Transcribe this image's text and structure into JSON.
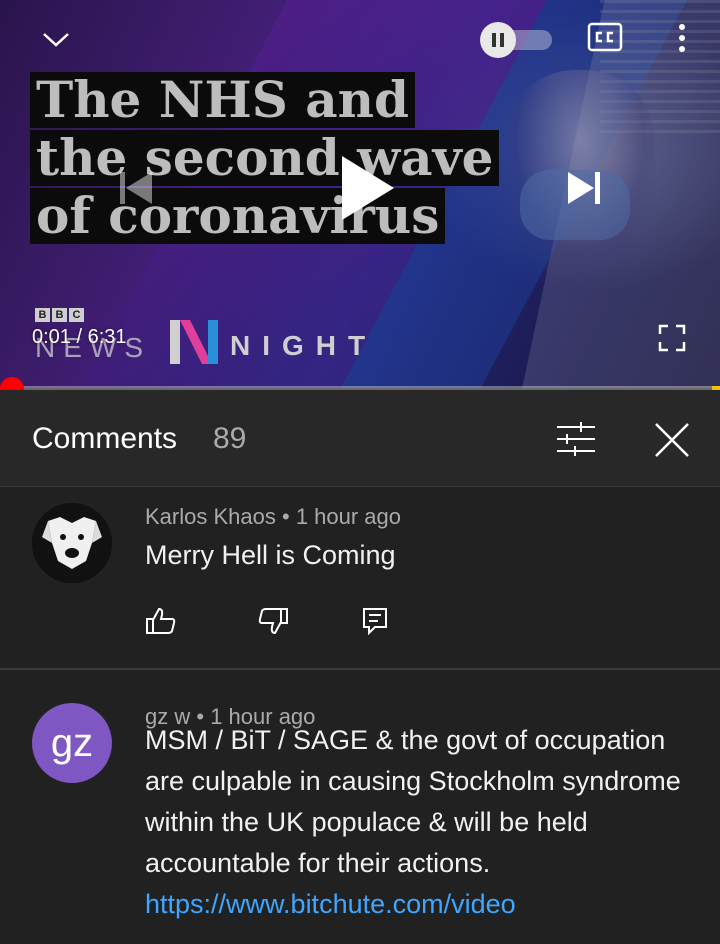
{
  "video": {
    "headline_lines": [
      "The NHS and",
      "the second wave",
      "of coronavirus"
    ],
    "bbc_letters": [
      "B",
      "B",
      "C"
    ],
    "news_word": "NEWS",
    "night_word": "NIGHT",
    "current_time": "0:01",
    "duration": "6:31",
    "progress_fraction": 0.003,
    "autoplay_on": false,
    "icons": {
      "collapse": "chevron-down-icon",
      "autoplay": "pause-icon",
      "captions": "closed-captions-icon",
      "more": "more-vertical-icon",
      "previous": "skip-previous-icon",
      "play": "play-icon",
      "next": "skip-next-icon",
      "fullscreen": "fullscreen-icon"
    }
  },
  "comments_panel": {
    "title": "Comments",
    "count": "89",
    "icons": {
      "filter": "sort-filter-icon",
      "close": "close-icon"
    }
  },
  "comments": [
    {
      "author": "Karlos Khaos",
      "separator": "•",
      "time": "1 hour ago",
      "text": "Merry Hell is Coming",
      "avatar_initials": ""
    },
    {
      "author": "gz w",
      "separator": "•",
      "time": "1 hour ago",
      "text": "MSM / BiT / SAGE & the govt of occupation are culpable in causing Stockholm syndrome within the UK populace & will be held accountable for their actions.",
      "link": "https://www.bitchute.com/video",
      "avatar_initials": "gz",
      "avatar_color": "#7e57c2"
    }
  ],
  "colors": {
    "background": "#212121",
    "header_bg": "#282828",
    "progress": "#ff0000",
    "link": "#3ea6ff",
    "secondary_text": "#aaaaaa"
  }
}
